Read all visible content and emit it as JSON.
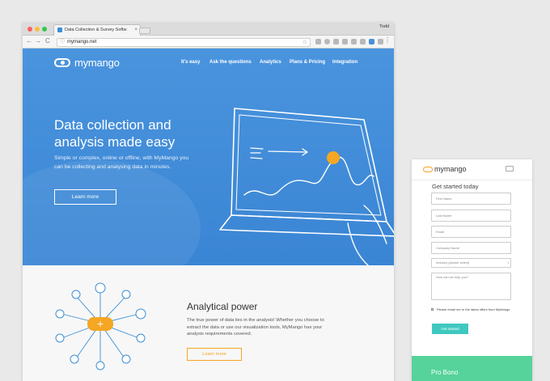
{
  "browser": {
    "tab_title": "Data Collection & Survey Softw",
    "tab_close": "×",
    "profile_name": "Todd",
    "url": "mymango.net",
    "back": "←",
    "forward": "→",
    "reload": "C",
    "star": "☆",
    "menu": "⋮"
  },
  "site": {
    "logo_text": "mymango",
    "nav": [
      "It's easy",
      "Ask the questions",
      "Analytics",
      "Plans & Pricing",
      "Integration"
    ],
    "hero": {
      "headline": "Data collection and analysis made easy",
      "body": "Simple or complex, online or offline, with MyMango you can be collecting and analysing data in minutes.",
      "cta": "Learn more"
    },
    "analytics": {
      "title": "Analytical power",
      "body": "The true power of data lies in the analysis! Whether you choose to extract the data or use our visualization tools, MyMango has your analysis requirements covered.",
      "cta": "Learn more"
    },
    "colors": {
      "hero_blue": "#4a94de",
      "accent_orange": "#f5a623",
      "teal": "#3fc8c0",
      "green": "#55d39a"
    }
  },
  "mobile": {
    "logo_text": "mymango",
    "form_title": "Get started today",
    "fields": {
      "first_name": "First Name",
      "last_name": "Last Name",
      "email": "Email",
      "company": "Company Name",
      "industry": "Industry (please select)",
      "message": "How can we help you?"
    },
    "checkbox_label": "Please email me re the latest offers from MyMango.",
    "submit": "Get started",
    "section_title": "Pro Bono"
  }
}
